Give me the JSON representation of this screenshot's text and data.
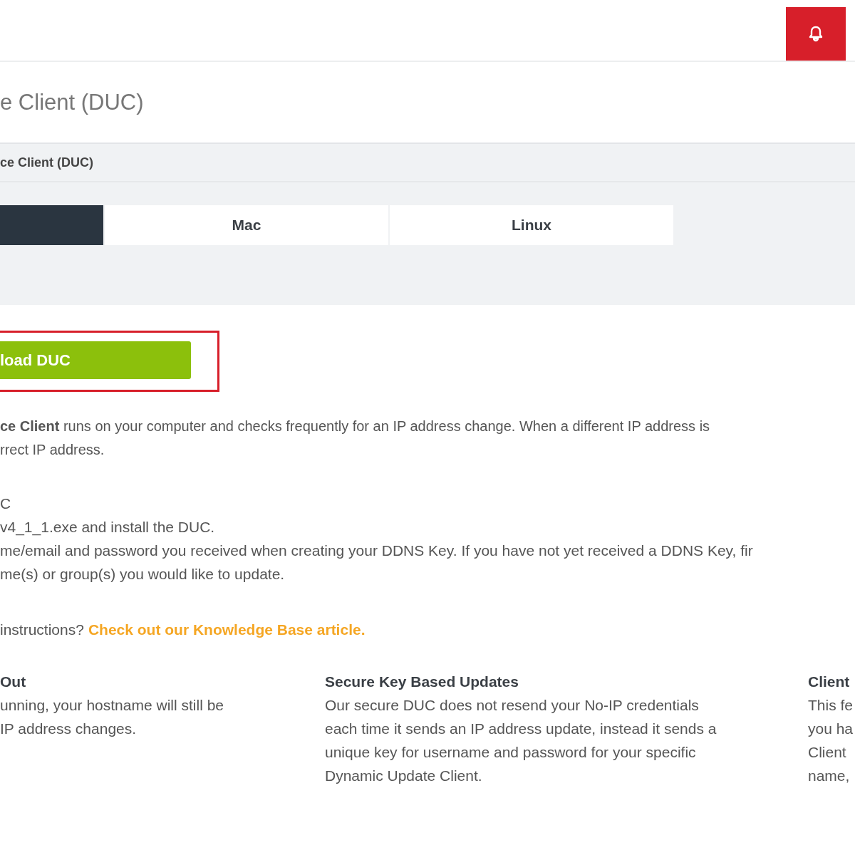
{
  "page_title": "e Client (DUC)",
  "panel": {
    "title": "ce Client (DUC)",
    "tabs": [
      {
        "selected": true
      },
      {
        "label": "Mac",
        "selected": false
      },
      {
        "label": "Linux",
        "selected": false
      }
    ]
  },
  "download_button": {
    "label": "load DUC",
    "highlighted": true
  },
  "description": [
    "**ce Client** runs on your computer and checks frequently for an IP address change. When a different IP address is",
    "rrect IP address."
  ],
  "steps": [
    "C",
    "v4_1_1.exe and install the DUC.",
    "me/email and password you received when creating your DDNS Key. If you have not yet received a DDNS Key, fir",
    "me(s) or group(s) you would like to update."
  ],
  "help": {
    "text": "instructions?",
    "link": "Check out our Knowledge Base article."
  },
  "features": [
    {
      "title": "Out",
      "lines": [
        "unning, your hostname will still be",
        "IP address changes."
      ]
    },
    {
      "title": "Secure Key Based Updates",
      "lines": [
        "Our secure DUC does not resend your No-IP credentials",
        "each time it sends an IP address update, instead it sends a",
        "unique key for username and password for your specific",
        "Dynamic Update Client."
      ]
    },
    {
      "title": "Client",
      "lines": [
        "This fe",
        "you ha",
        "Client",
        "name,"
      ]
    }
  ]
}
